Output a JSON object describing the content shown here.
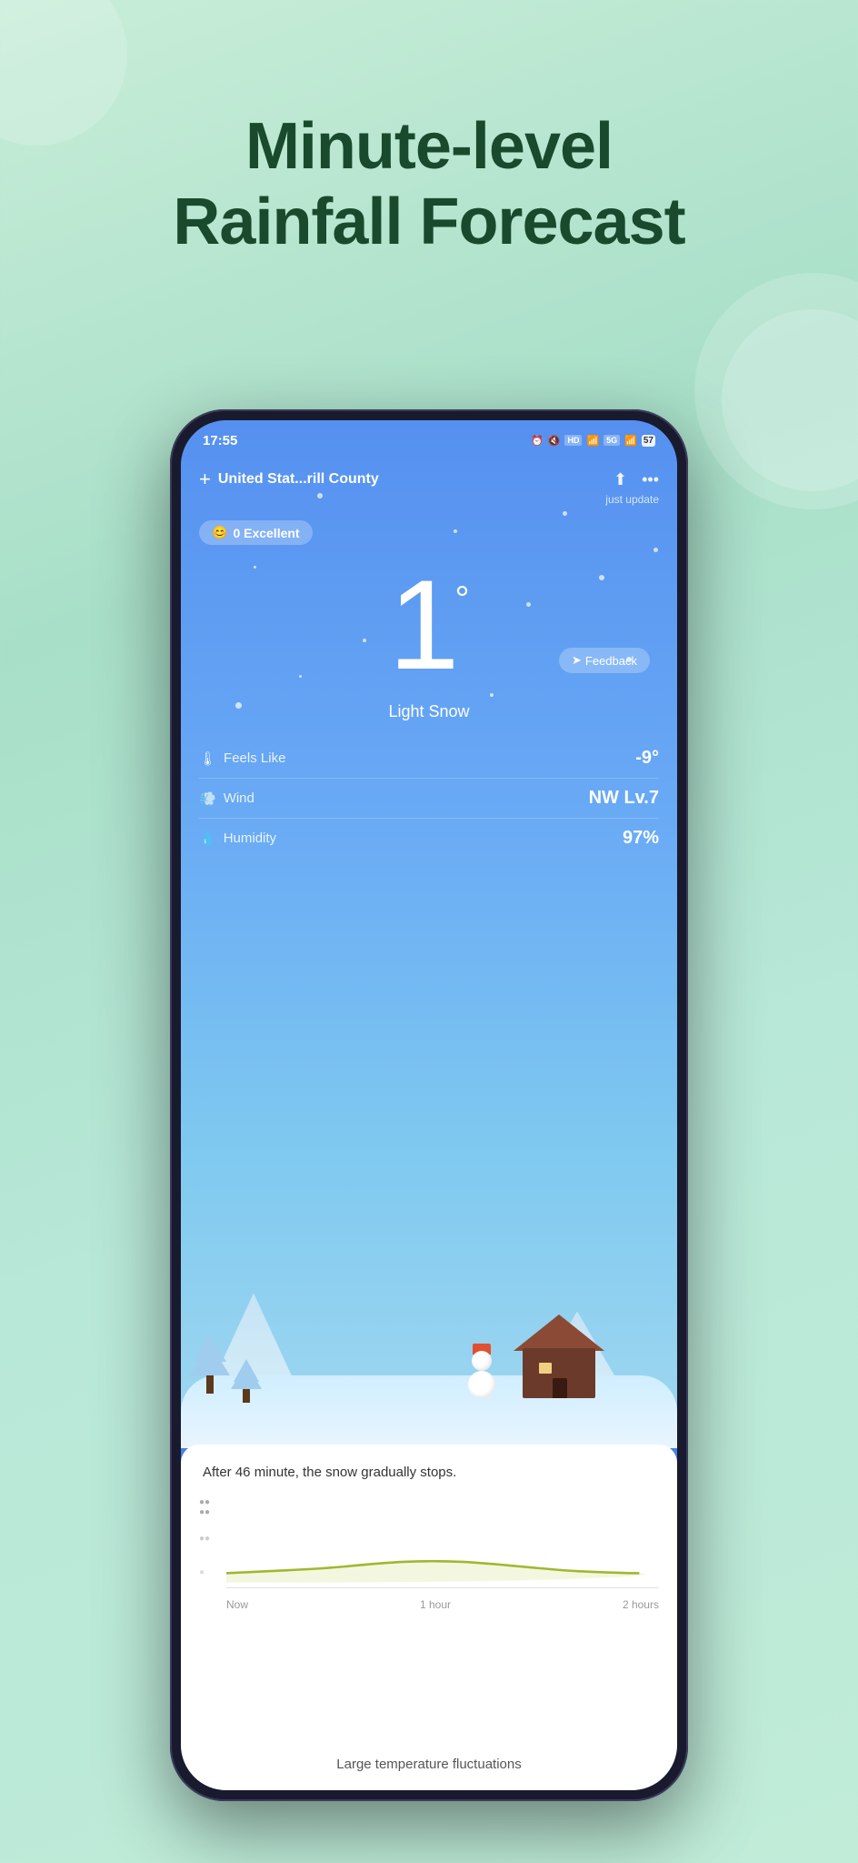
{
  "hero": {
    "title_line1": "Minute-level",
    "title_line2": "Rainfall Forecast"
  },
  "phone": {
    "status_bar": {
      "time": "17:55",
      "icons": "🔔 🔇 HD 📶 5G 🔋 57"
    },
    "header": {
      "add_label": "+",
      "location": "United Stat...rill County",
      "update_time": "just update"
    },
    "aqi": {
      "emoji": "😊",
      "label": "0 Excellent"
    },
    "temperature": {
      "value": "1",
      "degree": "°"
    },
    "feedback": {
      "label": "Feedback"
    },
    "condition": {
      "label": "Light Snow"
    },
    "stats": {
      "feels_like": {
        "label": "Feels Like",
        "value": "-9°"
      },
      "wind": {
        "label": "Wind",
        "value": "NW Lv.7"
      },
      "humidity": {
        "label": "Humidity",
        "value": "97%"
      }
    },
    "forecast": {
      "message": "After 46 minute, the snow gradually stops.",
      "time_labels": [
        "Now",
        "1 hour",
        "2 hours"
      ]
    },
    "bottom_notice": "Large temperature fluctuations"
  }
}
